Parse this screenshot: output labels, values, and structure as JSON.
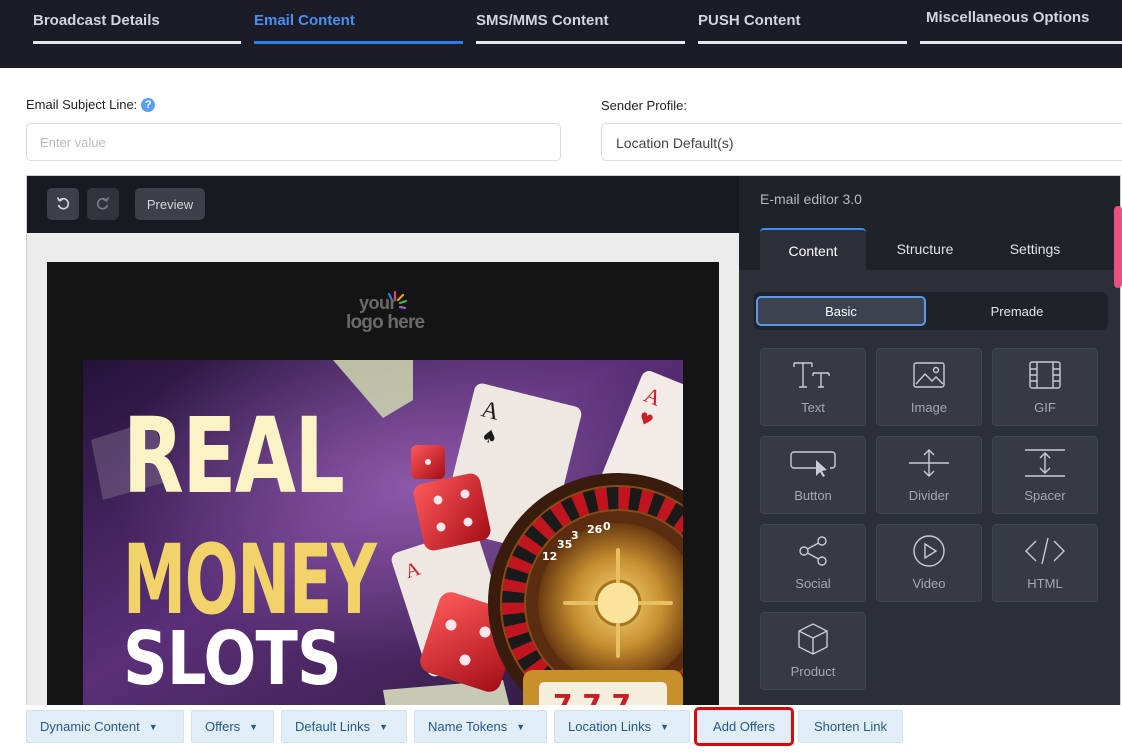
{
  "top_tabs": [
    {
      "label": "Broadcast Details",
      "active": false
    },
    {
      "label": "Email Content",
      "active": true
    },
    {
      "label": "SMS/MMS Content",
      "active": false
    },
    {
      "label": "PUSH Content",
      "active": false
    },
    {
      "label": "Miscellaneous Options",
      "active": false
    }
  ],
  "form": {
    "subject_label": "Email Subject Line:",
    "subject_help_icon": "?",
    "subject_placeholder": "Enter value",
    "subject_value": "",
    "sender_label": "Sender Profile:",
    "sender_value": "Location Default(s)"
  },
  "editor": {
    "toolbar": {
      "undo_icon": "undo-icon",
      "redo_icon": "redo-icon",
      "preview_label": "Preview"
    },
    "email": {
      "logo_text_1": "your",
      "logo_text_2": "logo here",
      "hero_line_1": "REAL",
      "hero_line_2": "MONEY",
      "hero_line_3": "SLOTS",
      "card_rank": "A",
      "roulette_numbers": [
        "0",
        "26",
        "3",
        "35",
        "12"
      ]
    },
    "panel": {
      "title": "E-mail editor 3.0",
      "tabs": [
        {
          "label": "Content",
          "active": true
        },
        {
          "label": "Structure",
          "active": false
        },
        {
          "label": "Settings",
          "active": false
        }
      ],
      "segments": [
        {
          "label": "Basic",
          "active": true
        },
        {
          "label": "Premade",
          "active": false
        }
      ],
      "blocks": [
        {
          "label": "Text",
          "icon": "text-icon"
        },
        {
          "label": "Image",
          "icon": "image-icon"
        },
        {
          "label": "GIF",
          "icon": "gif-icon"
        },
        {
          "label": "Button",
          "icon": "button-icon"
        },
        {
          "label": "Divider",
          "icon": "divider-icon"
        },
        {
          "label": "Spacer",
          "icon": "spacer-icon"
        },
        {
          "label": "Social",
          "icon": "share-icon"
        },
        {
          "label": "Video",
          "icon": "play-icon"
        },
        {
          "label": "HTML",
          "icon": "code-icon"
        },
        {
          "label": "Product",
          "icon": "box-icon"
        }
      ]
    }
  },
  "bottom_bar": {
    "buttons": [
      {
        "label": "Dynamic Content",
        "dropdown": true
      },
      {
        "label": "Offers",
        "dropdown": true
      },
      {
        "label": "Default Links",
        "dropdown": true
      },
      {
        "label": "Name Tokens",
        "dropdown": true
      },
      {
        "label": "Location Links",
        "dropdown": true
      },
      {
        "label": "Add Offers",
        "dropdown": false,
        "highlighted": true
      },
      {
        "label": "Shorten Link",
        "dropdown": false
      }
    ],
    "highlight_color": "#d00d0d"
  },
  "colors": {
    "topbar_bg": "#1c1c28",
    "active_tab": "#2f7de8",
    "editor_panel_bg": "#1f2229",
    "panel_accent": "#3f8ef0",
    "merge_button_bg": "#e2eef7",
    "merge_button_text": "#235a8a"
  }
}
